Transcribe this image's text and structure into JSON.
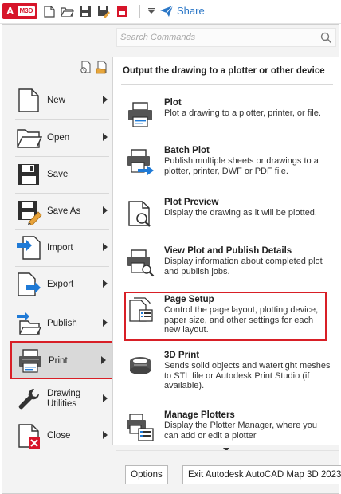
{
  "app": {
    "button_letter": "A",
    "button_sub": "M3D"
  },
  "toolbar": {
    "share_label": "Share",
    "buttons": [
      "new-icon",
      "open-icon",
      "save-icon",
      "save-as-icon",
      "plot-icon",
      "undo-icon",
      "customize-icon"
    ]
  },
  "search": {
    "placeholder": "Search Commands"
  },
  "left_menu": {
    "items": [
      {
        "label": "New",
        "icon": "new-file-icon",
        "has_submenu": true
      },
      {
        "label": "Open",
        "icon": "open-folder-icon",
        "has_submenu": true
      },
      {
        "label": "Save",
        "icon": "save-icon",
        "has_submenu": false
      },
      {
        "label": "Save As",
        "icon": "save-as-icon",
        "has_submenu": true
      },
      {
        "label": "Import",
        "icon": "import-icon",
        "has_submenu": true
      },
      {
        "label": "Export",
        "icon": "export-icon",
        "has_submenu": true
      },
      {
        "label": "Publish",
        "icon": "publish-icon",
        "has_submenu": true
      },
      {
        "label": "Print",
        "icon": "printer-icon",
        "has_submenu": true,
        "selected": true
      },
      {
        "label": "Drawing\nUtilities",
        "icon": "wrench-icon",
        "has_submenu": true
      },
      {
        "label": "Close",
        "icon": "close-file-icon",
        "has_submenu": true
      }
    ]
  },
  "right_panel": {
    "title": "Output the drawing to a plotter or other device",
    "items": [
      {
        "title": "Plot",
        "desc": "Plot a drawing to a plotter, printer, or file.",
        "icon": "plot-printer-icon"
      },
      {
        "title": "Batch Plot",
        "desc": "Publish multiple sheets or drawings to a plotter, printer, DWF or PDF file.",
        "icon": "batch-plot-icon"
      },
      {
        "title": "Plot Preview",
        "desc": "Display the drawing as it will be plotted.",
        "icon": "plot-preview-icon"
      },
      {
        "title": "View Plot and Publish Details",
        "desc": "Display information about completed plot and publish jobs.",
        "icon": "plot-details-icon"
      },
      {
        "title": "Page Setup",
        "desc": "Control the page layout, plotting device, paper size, and other settings for each new layout.",
        "icon": "page-setup-icon",
        "selected": true
      },
      {
        "title": "3D Print",
        "desc": "Sends solid objects and watertight meshes to STL file or Autodesk Print Studio (if available).",
        "icon": "3d-print-icon"
      },
      {
        "title": "Manage Plotters",
        "desc": "Display the Plotter Manager, where you can add or edit a plotter",
        "icon": "manage-plotters-icon"
      }
    ]
  },
  "footer": {
    "options_label": "Options",
    "exit_label": "Exit Autodesk AutoCAD Map 3D 2023"
  },
  "colors": {
    "highlight": "#d81f26",
    "accent_blue": "#1f7ad6",
    "brand_red": "#d7152a"
  }
}
